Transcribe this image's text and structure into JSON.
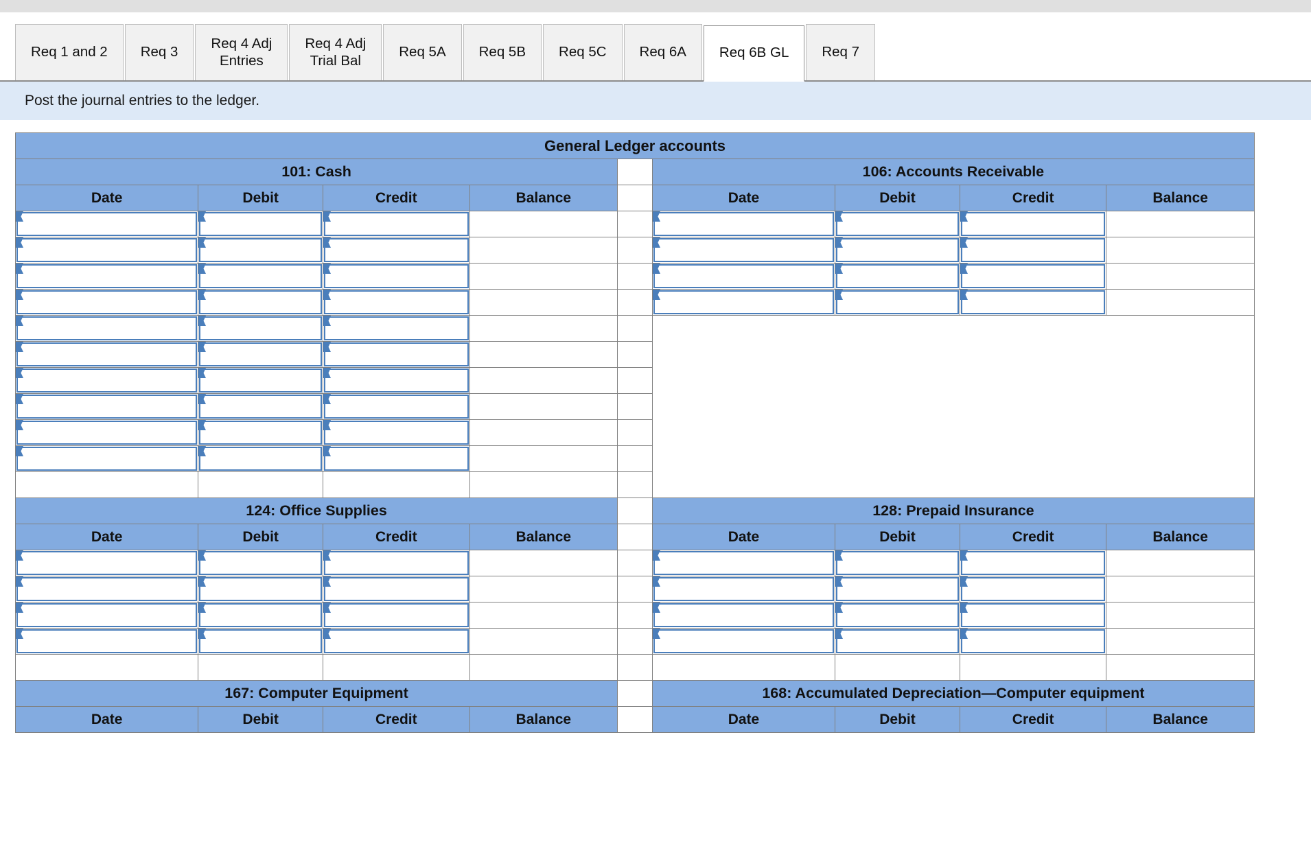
{
  "window": {
    "top_strip_color": "#e0e0e0"
  },
  "tabs": {
    "items": [
      {
        "label": "Req 1 and 2",
        "active": false
      },
      {
        "label": "Req 3",
        "active": false
      },
      {
        "label": "Req 4 Adj\nEntries",
        "active": false
      },
      {
        "label": "Req 4 Adj\nTrial Bal",
        "active": false
      },
      {
        "label": "Req 5A",
        "active": false
      },
      {
        "label": "Req 5B",
        "active": false
      },
      {
        "label": "Req 5C",
        "active": false
      },
      {
        "label": "Req 6A",
        "active": false
      },
      {
        "label": "Req 6B GL",
        "active": true
      },
      {
        "label": "Req 7",
        "active": false
      }
    ]
  },
  "instruction": {
    "text": "Post the journal entries to the ledger."
  },
  "ledger": {
    "title": "General Ledger accounts",
    "column_headers": [
      "Date",
      "Debit",
      "Credit",
      "Balance"
    ],
    "accent_header_color": "#83abe0",
    "input_border_color": "#4a7ebb",
    "grid_line_color": "#808080",
    "rows": [
      {
        "left": {
          "account": "101: Cash",
          "input_rows": 10,
          "trailing_blank_rows": 1
        },
        "right": {
          "account": "106: Accounts Receivable",
          "input_rows": 4,
          "trailing_blank_rows": 1
        }
      },
      {
        "left": {
          "account": "124: Office Supplies",
          "input_rows": 4,
          "trailing_blank_rows": 1
        },
        "right": {
          "account": "128: Prepaid Insurance",
          "input_rows": 4,
          "trailing_blank_rows": 1
        }
      },
      {
        "left": {
          "account": "167: Computer Equipment",
          "input_rows": 0,
          "trailing_blank_rows": 0
        },
        "right": {
          "account": "168: Accumulated Depreciation—Computer equipment",
          "input_rows": 0,
          "trailing_blank_rows": 0
        }
      }
    ]
  }
}
